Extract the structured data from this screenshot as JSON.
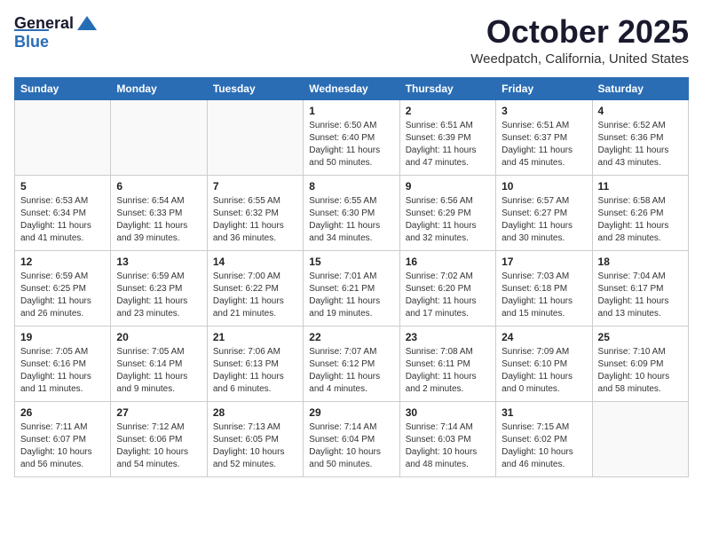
{
  "logo": {
    "general": "General",
    "blue": "Blue"
  },
  "header": {
    "month": "October 2025",
    "location": "Weedpatch, California, United States"
  },
  "days_of_week": [
    "Sunday",
    "Monday",
    "Tuesday",
    "Wednesday",
    "Thursday",
    "Friday",
    "Saturday"
  ],
  "weeks": [
    [
      {
        "day": "",
        "info": ""
      },
      {
        "day": "",
        "info": ""
      },
      {
        "day": "",
        "info": ""
      },
      {
        "day": "1",
        "info": "Sunrise: 6:50 AM\nSunset: 6:40 PM\nDaylight: 11 hours\nand 50 minutes."
      },
      {
        "day": "2",
        "info": "Sunrise: 6:51 AM\nSunset: 6:39 PM\nDaylight: 11 hours\nand 47 minutes."
      },
      {
        "day": "3",
        "info": "Sunrise: 6:51 AM\nSunset: 6:37 PM\nDaylight: 11 hours\nand 45 minutes."
      },
      {
        "day": "4",
        "info": "Sunrise: 6:52 AM\nSunset: 6:36 PM\nDaylight: 11 hours\nand 43 minutes."
      }
    ],
    [
      {
        "day": "5",
        "info": "Sunrise: 6:53 AM\nSunset: 6:34 PM\nDaylight: 11 hours\nand 41 minutes."
      },
      {
        "day": "6",
        "info": "Sunrise: 6:54 AM\nSunset: 6:33 PM\nDaylight: 11 hours\nand 39 minutes."
      },
      {
        "day": "7",
        "info": "Sunrise: 6:55 AM\nSunset: 6:32 PM\nDaylight: 11 hours\nand 36 minutes."
      },
      {
        "day": "8",
        "info": "Sunrise: 6:55 AM\nSunset: 6:30 PM\nDaylight: 11 hours\nand 34 minutes."
      },
      {
        "day": "9",
        "info": "Sunrise: 6:56 AM\nSunset: 6:29 PM\nDaylight: 11 hours\nand 32 minutes."
      },
      {
        "day": "10",
        "info": "Sunrise: 6:57 AM\nSunset: 6:27 PM\nDaylight: 11 hours\nand 30 minutes."
      },
      {
        "day": "11",
        "info": "Sunrise: 6:58 AM\nSunset: 6:26 PM\nDaylight: 11 hours\nand 28 minutes."
      }
    ],
    [
      {
        "day": "12",
        "info": "Sunrise: 6:59 AM\nSunset: 6:25 PM\nDaylight: 11 hours\nand 26 minutes."
      },
      {
        "day": "13",
        "info": "Sunrise: 6:59 AM\nSunset: 6:23 PM\nDaylight: 11 hours\nand 23 minutes."
      },
      {
        "day": "14",
        "info": "Sunrise: 7:00 AM\nSunset: 6:22 PM\nDaylight: 11 hours\nand 21 minutes."
      },
      {
        "day": "15",
        "info": "Sunrise: 7:01 AM\nSunset: 6:21 PM\nDaylight: 11 hours\nand 19 minutes."
      },
      {
        "day": "16",
        "info": "Sunrise: 7:02 AM\nSunset: 6:20 PM\nDaylight: 11 hours\nand 17 minutes."
      },
      {
        "day": "17",
        "info": "Sunrise: 7:03 AM\nSunset: 6:18 PM\nDaylight: 11 hours\nand 15 minutes."
      },
      {
        "day": "18",
        "info": "Sunrise: 7:04 AM\nSunset: 6:17 PM\nDaylight: 11 hours\nand 13 minutes."
      }
    ],
    [
      {
        "day": "19",
        "info": "Sunrise: 7:05 AM\nSunset: 6:16 PM\nDaylight: 11 hours\nand 11 minutes."
      },
      {
        "day": "20",
        "info": "Sunrise: 7:05 AM\nSunset: 6:14 PM\nDaylight: 11 hours\nand 9 minutes."
      },
      {
        "day": "21",
        "info": "Sunrise: 7:06 AM\nSunset: 6:13 PM\nDaylight: 11 hours\nand 6 minutes."
      },
      {
        "day": "22",
        "info": "Sunrise: 7:07 AM\nSunset: 6:12 PM\nDaylight: 11 hours\nand 4 minutes."
      },
      {
        "day": "23",
        "info": "Sunrise: 7:08 AM\nSunset: 6:11 PM\nDaylight: 11 hours\nand 2 minutes."
      },
      {
        "day": "24",
        "info": "Sunrise: 7:09 AM\nSunset: 6:10 PM\nDaylight: 11 hours\nand 0 minutes."
      },
      {
        "day": "25",
        "info": "Sunrise: 7:10 AM\nSunset: 6:09 PM\nDaylight: 10 hours\nand 58 minutes."
      }
    ],
    [
      {
        "day": "26",
        "info": "Sunrise: 7:11 AM\nSunset: 6:07 PM\nDaylight: 10 hours\nand 56 minutes."
      },
      {
        "day": "27",
        "info": "Sunrise: 7:12 AM\nSunset: 6:06 PM\nDaylight: 10 hours\nand 54 minutes."
      },
      {
        "day": "28",
        "info": "Sunrise: 7:13 AM\nSunset: 6:05 PM\nDaylight: 10 hours\nand 52 minutes."
      },
      {
        "day": "29",
        "info": "Sunrise: 7:14 AM\nSunset: 6:04 PM\nDaylight: 10 hours\nand 50 minutes."
      },
      {
        "day": "30",
        "info": "Sunrise: 7:14 AM\nSunset: 6:03 PM\nDaylight: 10 hours\nand 48 minutes."
      },
      {
        "day": "31",
        "info": "Sunrise: 7:15 AM\nSunset: 6:02 PM\nDaylight: 10 hours\nand 46 minutes."
      },
      {
        "day": "",
        "info": ""
      }
    ]
  ]
}
